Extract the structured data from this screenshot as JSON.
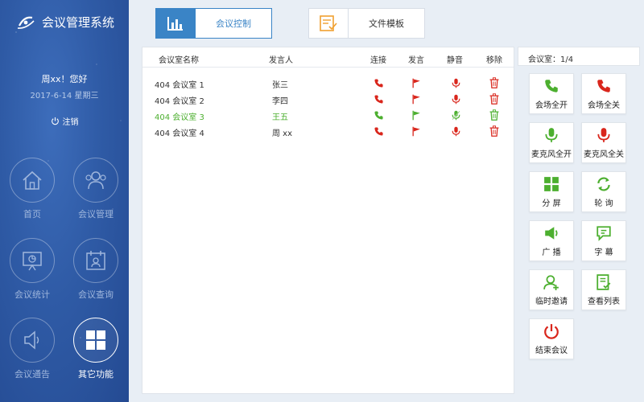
{
  "colors": {
    "red": "#d9261c",
    "green": "#4caf2f",
    "accent": "#3a84c6"
  },
  "sidebar": {
    "app_title": "会议管理系统",
    "greeting": "周xx！您好",
    "date": "2017-6-14  星期三",
    "logout": "注销",
    "nav": [
      {
        "label": "首页",
        "icon": "home-icon"
      },
      {
        "label": "会议管理",
        "icon": "users-icon"
      },
      {
        "label": "会议统计",
        "icon": "chart-board-icon"
      },
      {
        "label": "会议查询",
        "icon": "calendar-user-icon"
      },
      {
        "label": "会议通告",
        "icon": "speaker-icon"
      },
      {
        "label": "其它功能",
        "icon": "grid-icon",
        "active": true
      }
    ]
  },
  "tabs": [
    {
      "label": "会议控制",
      "icon": "bar-chart-icon",
      "active": true
    },
    {
      "label": "文件模板",
      "icon": "document-check-icon",
      "active": false
    }
  ],
  "table": {
    "headers": {
      "name": "会议室名称",
      "speaker": "发言人",
      "connect": "连接",
      "speak": "发言",
      "mute": "静音",
      "remove": "移除"
    },
    "rows": [
      {
        "name": "404 会议室 1",
        "speaker": "张三",
        "status": "red"
      },
      {
        "name": "404 会议室 2",
        "speaker": "李四",
        "status": "red"
      },
      {
        "name": "404 会议室 3",
        "speaker": "王五",
        "status": "green"
      },
      {
        "name": "404 会议室 4",
        "speaker": "周 xx",
        "status": "red"
      }
    ]
  },
  "right": {
    "header": "会议室：1/4",
    "buttons": [
      {
        "label": "会场全开",
        "icon": "phone-icon",
        "color": "green"
      },
      {
        "label": "会场全关",
        "icon": "phone-icon",
        "color": "red"
      },
      {
        "label": "麦克风全开",
        "icon": "microphone-icon",
        "color": "green"
      },
      {
        "label": "麦克风全关",
        "icon": "microphone-icon",
        "color": "red"
      },
      {
        "label": "分  屏",
        "icon": "split-screen-icon",
        "color": "green"
      },
      {
        "label": "轮  询",
        "icon": "refresh-icon",
        "color": "green"
      },
      {
        "label": "广  播",
        "icon": "broadcast-icon",
        "color": "green"
      },
      {
        "label": "字  幕",
        "icon": "subtitle-icon",
        "color": "green"
      },
      {
        "label": "临时邀请",
        "icon": "add-user-icon",
        "color": "green"
      },
      {
        "label": "查看列表",
        "icon": "list-check-icon",
        "color": "green"
      },
      {
        "label": "结束会议",
        "icon": "power-icon",
        "color": "red"
      }
    ]
  }
}
